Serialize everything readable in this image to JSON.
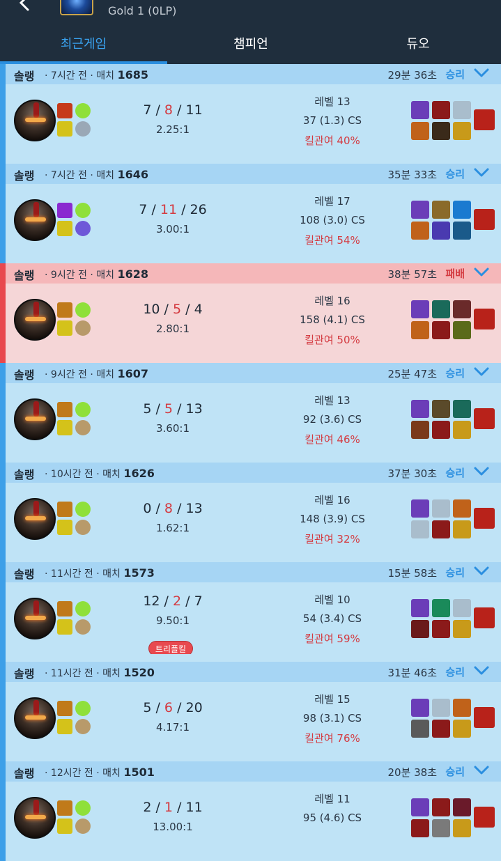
{
  "header": {
    "rank_text": "Gold 1 (0LP)"
  },
  "tabs": [
    {
      "label": "최근게임",
      "active": true
    },
    {
      "label": "챔피언",
      "active": false
    },
    {
      "label": "듀오",
      "active": false
    }
  ],
  "games": [
    {
      "queue": "솔랭",
      "ago": "7시간 전",
      "match_label": "매치",
      "match_no": "1685",
      "duration": "29분 36초",
      "result": "승리",
      "outcome": "win",
      "kills": "7",
      "deaths": "8",
      "assists": "11",
      "ratio": "2.25:1",
      "level": "레벨 13",
      "cs": "37 (1.3) CS",
      "kp": "킬관여 40%",
      "badge": "",
      "spells": [
        "#c63a1a",
        "#d4c21a"
      ],
      "runes": [
        "#8fe03a",
        "#9aa8b6"
      ],
      "items": [
        "#6b3db8",
        "#8b1a1a",
        "",
        "#c0621a",
        "#3a2a1a",
        "#c89a1a"
      ],
      "ward": "#b8221a"
    },
    {
      "queue": "솔랭",
      "ago": "7시간 전",
      "match_label": "매치",
      "match_no": "1646",
      "duration": "35분 33초",
      "result": "승리",
      "outcome": "win",
      "kills": "7",
      "deaths": "11",
      "assists": "26",
      "ratio": "3.00:1",
      "level": "레벨 17",
      "cs": "108 (3.0) CS",
      "kp": "킬관여 54%",
      "badge": "",
      "spells": [
        "#8a2ad0",
        "#d4c21a"
      ],
      "runes": [
        "#8fe03a",
        "#6e58d8"
      ],
      "items": [
        "#6b3db8",
        "#8a6a2a",
        "#1a7ad0",
        "#c0621a",
        "#4a3ab0",
        "#1a5a8a"
      ],
      "ward": "#b8221a"
    },
    {
      "queue": "솔랭",
      "ago": "9시간 전",
      "match_label": "매치",
      "match_no": "1628",
      "duration": "38분 57초",
      "result": "패배",
      "outcome": "loss",
      "kills": "10",
      "deaths": "5",
      "assists": "4",
      "ratio": "2.80:1",
      "level": "레벨 16",
      "cs": "158 (4.1) CS",
      "kp": "킬관여 50%",
      "badge": "",
      "spells": [
        "#c07a1a",
        "#d4c21a"
      ],
      "runes": [
        "#8fe03a",
        "#b89a6a"
      ],
      "items": [
        "#6b3db8",
        "#1a6a5a",
        "#6a2a2a",
        "#c0621a",
        "#8b1a1a",
        "#5a6a1a"
      ],
      "ward": "#b8221a"
    },
    {
      "queue": "솔랭",
      "ago": "9시간 전",
      "match_label": "매치",
      "match_no": "1607",
      "duration": "25분 47초",
      "result": "승리",
      "outcome": "win",
      "kills": "5",
      "deaths": "5",
      "assists": "13",
      "ratio": "3.60:1",
      "level": "레벨 13",
      "cs": "92 (3.6) CS",
      "kp": "킬관여 46%",
      "badge": "",
      "spells": [
        "#c07a1a",
        "#d4c21a"
      ],
      "runes": [
        "#8fe03a",
        "#b89a6a"
      ],
      "items": [
        "#6b3db8",
        "#5a4a2a",
        "#1a6a5a",
        "#7a3a1a",
        "#8b1a1a",
        "#c89a1a"
      ],
      "ward": "#b8221a"
    },
    {
      "queue": "솔랭",
      "ago": "10시간 전",
      "match_label": "매치",
      "match_no": "1626",
      "duration": "37분 30초",
      "result": "승리",
      "outcome": "win",
      "kills": "0",
      "deaths": "8",
      "assists": "13",
      "ratio": "1.62:1",
      "level": "레벨 16",
      "cs": "148 (3.9) CS",
      "kp": "킬관여 32%",
      "badge": "",
      "spells": [
        "#c07a1a",
        "#d4c21a"
      ],
      "runes": [
        "#8fe03a",
        "#b89a6a"
      ],
      "items": [
        "#6b3db8",
        "",
        "#c0621a",
        "",
        "#8b1a1a",
        "#c89a1a"
      ],
      "ward": "#b8221a"
    },
    {
      "queue": "솔랭",
      "ago": "11시간 전",
      "match_label": "매치",
      "match_no": "1573",
      "duration": "15분 58초",
      "result": "승리",
      "outcome": "win",
      "kills": "12",
      "deaths": "2",
      "assists": "7",
      "ratio": "9.50:1",
      "level": "레벨 10",
      "cs": "54 (3.4) CS",
      "kp": "킬관여 59%",
      "badge": "트리플킬",
      "spells": [
        "#c07a1a",
        "#d4c21a"
      ],
      "runes": [
        "#8fe03a",
        "#b89a6a"
      ],
      "items": [
        "#6b3db8",
        "#1a8a5a",
        "",
        "#6a1a1a",
        "#8b1a1a",
        "#c89a1a"
      ],
      "ward": "#b8221a"
    },
    {
      "queue": "솔랭",
      "ago": "11시간 전",
      "match_label": "매치",
      "match_no": "1520",
      "duration": "31분 46초",
      "result": "승리",
      "outcome": "win",
      "kills": "5",
      "deaths": "6",
      "assists": "20",
      "ratio": "4.17:1",
      "level": "레벨 15",
      "cs": "98 (3.1) CS",
      "kp": "킬관여 76%",
      "badge": "",
      "spells": [
        "#c07a1a",
        "#d4c21a"
      ],
      "runes": [
        "#8fe03a",
        "#b89a6a"
      ],
      "items": [
        "#6b3db8",
        "",
        "#c0621a",
        "#5a5a5a",
        "#8b1a1a",
        "#c89a1a"
      ],
      "ward": "#b8221a"
    },
    {
      "queue": "솔랭",
      "ago": "12시간 전",
      "match_label": "매치",
      "match_no": "1501",
      "duration": "20분 38초",
      "result": "승리",
      "outcome": "win",
      "kills": "2",
      "deaths": "1",
      "assists": "11",
      "ratio": "13.00:1",
      "level": "레벨 11",
      "cs": "95 (4.6) CS",
      "kp": "",
      "badge": "",
      "spells": [
        "#c07a1a",
        "#d4c21a"
      ],
      "runes": [
        "#8fe03a",
        "#b89a6a"
      ],
      "items": [
        "#6b3db8",
        "#8b1a1a",
        "#6a1a2a",
        "#8b1a1a",
        "#7a7a7a",
        "#c89a1a"
      ],
      "ward": "#b8221a"
    }
  ],
  "icons": {
    "back": "back-arrow-icon",
    "expand": "chevron-down-icon",
    "champion": "champion-portrait"
  },
  "colors": {
    "win_accent": "#2b8fe0",
    "loss_accent": "#d43a40",
    "header_bg": "#1f2e3d"
  }
}
